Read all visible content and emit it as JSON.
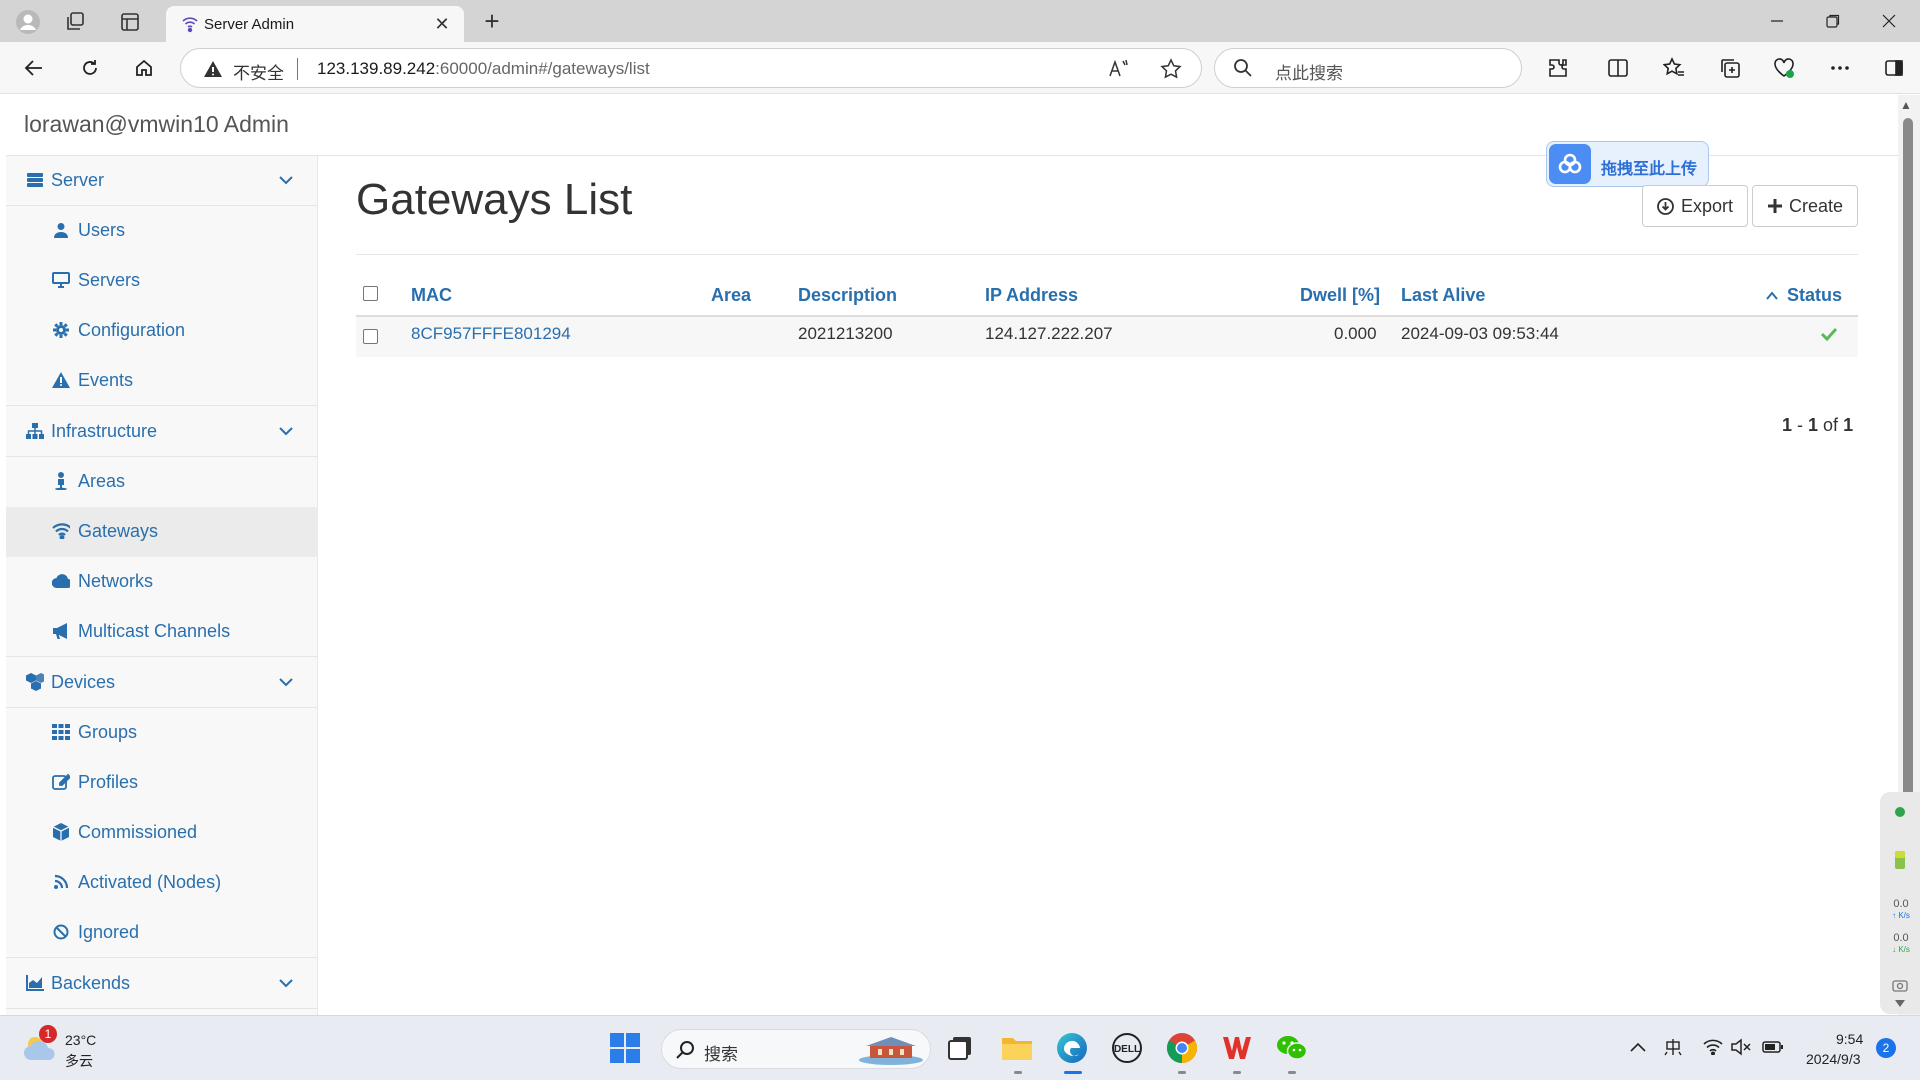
{
  "browser": {
    "tab_title": "Server Admin",
    "address": {
      "insecure_label": "不安全",
      "host": "123.139.89.242",
      "rest": ":60000/admin#/gateways/list"
    },
    "search_placeholder": "点此搜索"
  },
  "app": {
    "admin_title": "lorawan@vmwin10 Admin"
  },
  "sidebar": {
    "sections": [
      {
        "label": "Server",
        "icon": "server-icon",
        "items": [
          {
            "label": "Users",
            "icon": "user-icon"
          },
          {
            "label": "Servers",
            "icon": "monitor-icon"
          },
          {
            "label": "Configuration",
            "icon": "gear-icon"
          },
          {
            "label": "Events",
            "icon": "warning-icon"
          }
        ]
      },
      {
        "label": "Infrastructure",
        "icon": "sitemap-icon",
        "items": [
          {
            "label": "Areas",
            "icon": "person-pin-icon"
          },
          {
            "label": "Gateways",
            "icon": "wifi-icon",
            "active": true
          },
          {
            "label": "Networks",
            "icon": "cloud-icon"
          },
          {
            "label": "Multicast Channels",
            "icon": "bullhorn-icon"
          }
        ]
      },
      {
        "label": "Devices",
        "icon": "cubes-icon",
        "items": [
          {
            "label": "Groups",
            "icon": "grid-icon"
          },
          {
            "label": "Profiles",
            "icon": "edit-icon"
          },
          {
            "label": "Commissioned",
            "icon": "cube-icon"
          },
          {
            "label": "Activated (Nodes)",
            "icon": "rss-icon"
          },
          {
            "label": "Ignored",
            "icon": "ban-icon"
          }
        ]
      },
      {
        "label": "Backends",
        "icon": "chart-icon",
        "items": []
      }
    ]
  },
  "main": {
    "title": "Gateways List",
    "export_label": "Export",
    "create_label": "Create",
    "upload_badge_text": "拖拽至此上传",
    "table": {
      "columns": [
        "MAC",
        "Area",
        "Description",
        "IP Address",
        "Dwell [%]",
        "Last Alive",
        "Status"
      ],
      "rows": [
        {
          "mac": "8CF957FFFE801294",
          "area": "",
          "description": "2021213200",
          "ip": "124.127.222.207",
          "dwell": "0.000",
          "last_alive": "2024-09-03 09:53:44",
          "status": "ok"
        }
      ]
    },
    "pager": {
      "from": "1",
      "to": "1",
      "of_label": "of",
      "total": "1"
    }
  },
  "side_widget": {
    "upload_speed": "0.0",
    "download_speed": "0.0",
    "unit": "K/s"
  },
  "taskbar": {
    "weather_temp": "23°C",
    "weather_desc": "多云",
    "weather_badge": "1",
    "search_text": "搜索",
    "time": "9:54",
    "date": "2024/9/3",
    "notification_count": "2"
  },
  "colors": {
    "link": "#2a6fad",
    "status_ok": "#5cb85c",
    "accent": "#1a73e8"
  }
}
